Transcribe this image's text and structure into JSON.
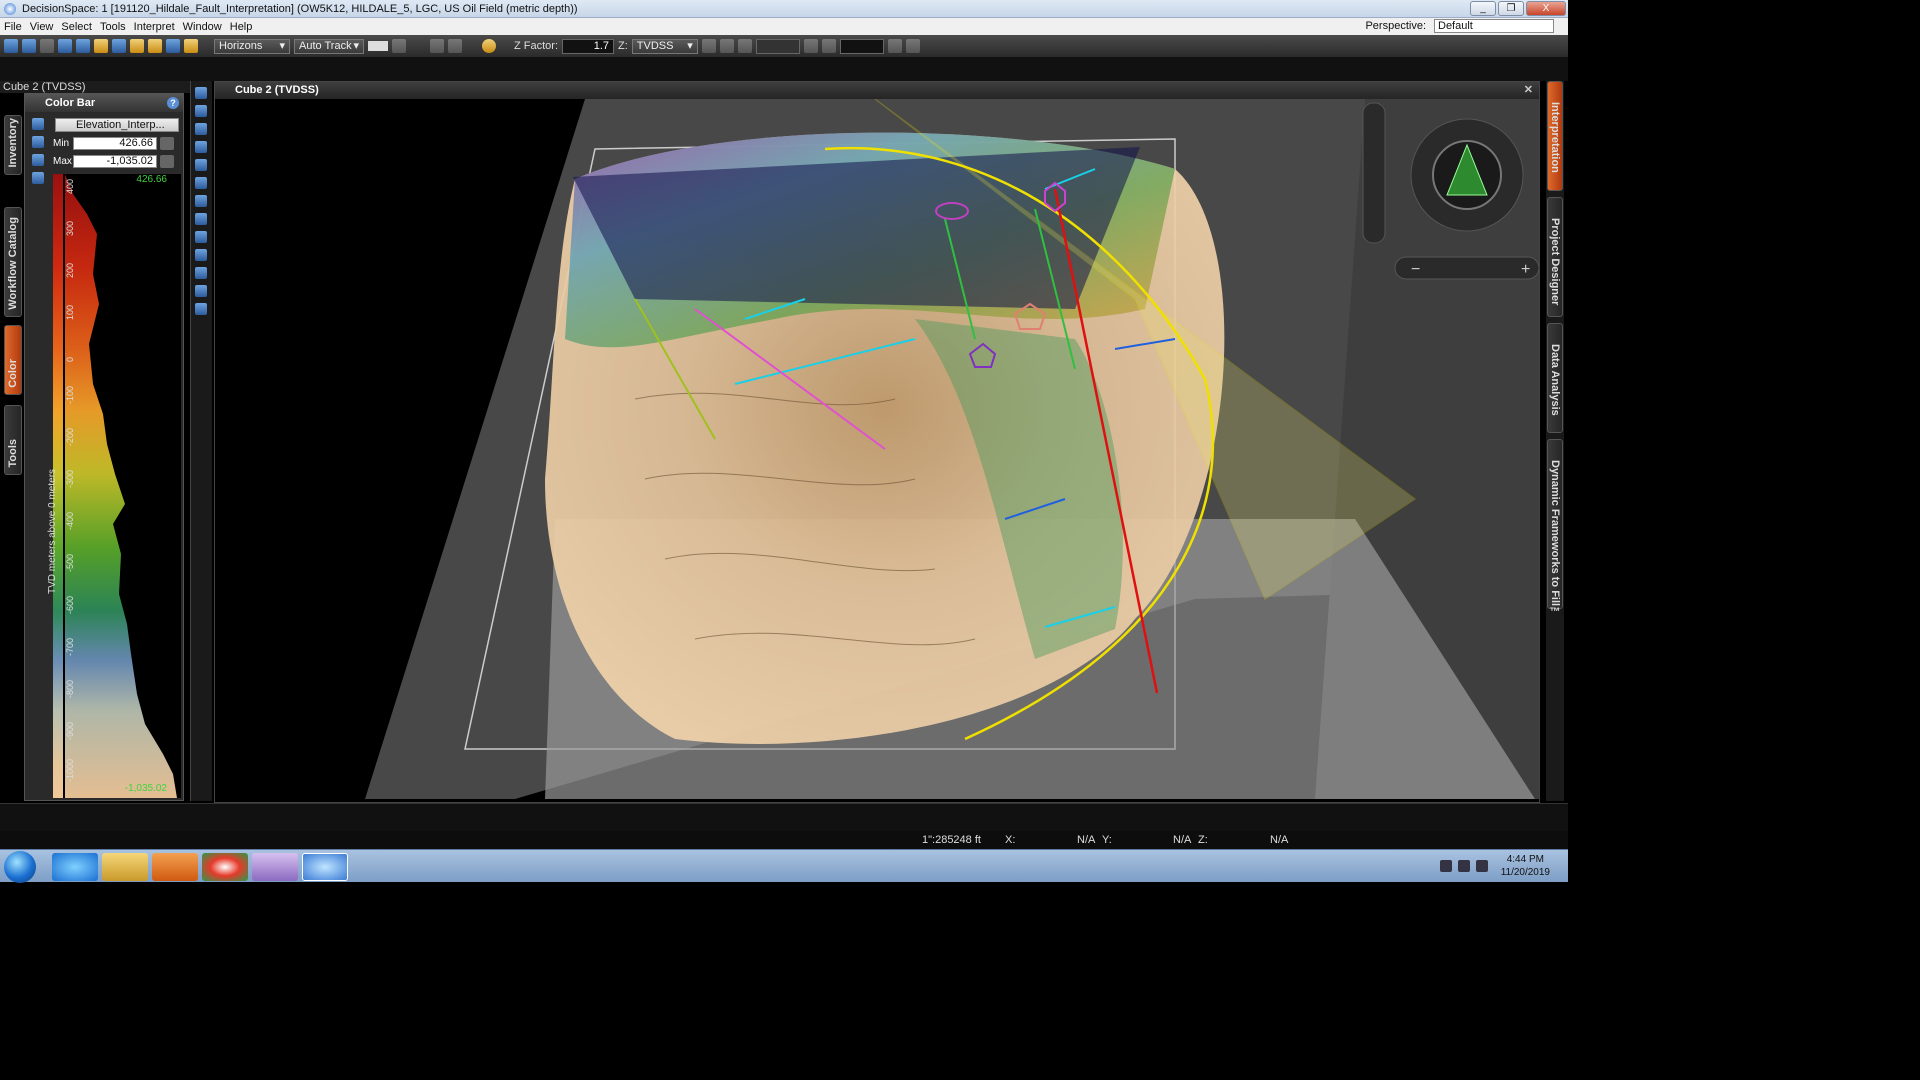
{
  "window": {
    "title": "DecisionSpace: 1 [191120_Hildale_Fault_Interpretation] (OW5K12, HILDALE_5, LGC, US Oil Field (metric depth))",
    "buttons": [
      "_",
      "❐",
      "X"
    ]
  },
  "menu": {
    "items": [
      "File",
      "View",
      "Select",
      "Tools",
      "Interpret",
      "Window",
      "Help"
    ],
    "perspective_label": "Perspective:",
    "perspective_value": "Default"
  },
  "toolbar": {
    "horizons": "Horizons",
    "autotrack": "Auto Track",
    "zfactor_label": "Z Factor:",
    "zfactor_value": "1.7",
    "z_label": "Z:",
    "z_value": "TVDSS"
  },
  "left_panel": {
    "title": "Cube 2 (TVDSS)",
    "vtabs": [
      "Inventory",
      "Workflow Catalog",
      "Color",
      "Tools"
    ],
    "colorbar": {
      "header": "Color Bar",
      "attribute": "Elevation_Interp...",
      "min_label": "Min",
      "min_value": "426.66",
      "max_label": "Max",
      "max_value": "-1,035.02",
      "top_marker": "426.66",
      "bottom_marker": "-1,035.02",
      "axis_label": "TVD meters above 0 meters",
      "ticks": [
        "400",
        "300",
        "200",
        "100",
        "0",
        "-100",
        "-200",
        "-300",
        "-400",
        "-500",
        "-600",
        "-700",
        "-800",
        "-900",
        "-1000"
      ]
    }
  },
  "viewport": {
    "title": "Cube 2 (TVDSS)",
    "close": "✕"
  },
  "right_tabs": [
    "Interpretation",
    "Project Designer",
    "Data Analysis",
    "Dynamic Frameworks to Fill™"
  ],
  "status": {
    "scale": "1\":285248 ft",
    "x_label": "X:",
    "x_value": "N/A",
    "y_label": "Y:",
    "y_value": "N/A",
    "z_label": "Z:",
    "z_value": "N/A"
  },
  "taskbar": {
    "time": "4:44 PM",
    "date": "11/20/2019"
  },
  "colors": {
    "yellow_lines": "#f0e000",
    "red_fault": "#e01010",
    "cyan_sticks": "#18d0e8"
  }
}
